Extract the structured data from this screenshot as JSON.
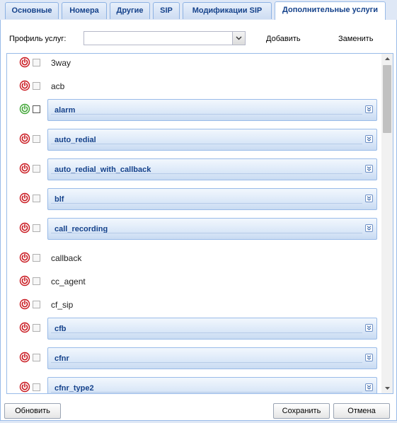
{
  "tabs": [
    {
      "label": "Основные",
      "active": false
    },
    {
      "label": "Номера",
      "active": false
    },
    {
      "label": "Другие",
      "active": false
    },
    {
      "label": "SIP",
      "active": false
    },
    {
      "label": "Модификации SIP",
      "active": false
    },
    {
      "label": "Дополнительные услуги",
      "active": true
    }
  ],
  "toolbar": {
    "profile_label": "Профиль услуг:",
    "profile_value": "",
    "add_label": "Добавить",
    "replace_label": "Заменить"
  },
  "services": [
    {
      "name": "3way",
      "enabled": false,
      "checked": false,
      "kind": "plain"
    },
    {
      "name": "acb",
      "enabled": false,
      "checked": false,
      "kind": "plain"
    },
    {
      "name": "alarm",
      "enabled": true,
      "checked": false,
      "kind": "group"
    },
    {
      "name": "auto_redial",
      "enabled": false,
      "checked": false,
      "kind": "group"
    },
    {
      "name": "auto_redial_with_callback",
      "enabled": false,
      "checked": false,
      "kind": "group"
    },
    {
      "name": "blf",
      "enabled": false,
      "checked": false,
      "kind": "group"
    },
    {
      "name": "call_recording",
      "enabled": false,
      "checked": false,
      "kind": "group"
    },
    {
      "name": "callback",
      "enabled": false,
      "checked": false,
      "kind": "plain"
    },
    {
      "name": "cc_agent",
      "enabled": false,
      "checked": false,
      "kind": "plain"
    },
    {
      "name": "cf_sip",
      "enabled": false,
      "checked": false,
      "kind": "plain"
    },
    {
      "name": "cfb",
      "enabled": false,
      "checked": false,
      "kind": "group"
    },
    {
      "name": "cfnr",
      "enabled": false,
      "checked": false,
      "kind": "group"
    },
    {
      "name": "cfnr_type2",
      "enabled": false,
      "checked": false,
      "kind": "group"
    }
  ],
  "footer": {
    "refresh_label": "Обновить",
    "save_label": "Сохранить",
    "cancel_label": "Отмена"
  },
  "colors": {
    "power_off": "#c8161d",
    "power_on": "#3fa535",
    "tab_text": "#15428b"
  }
}
